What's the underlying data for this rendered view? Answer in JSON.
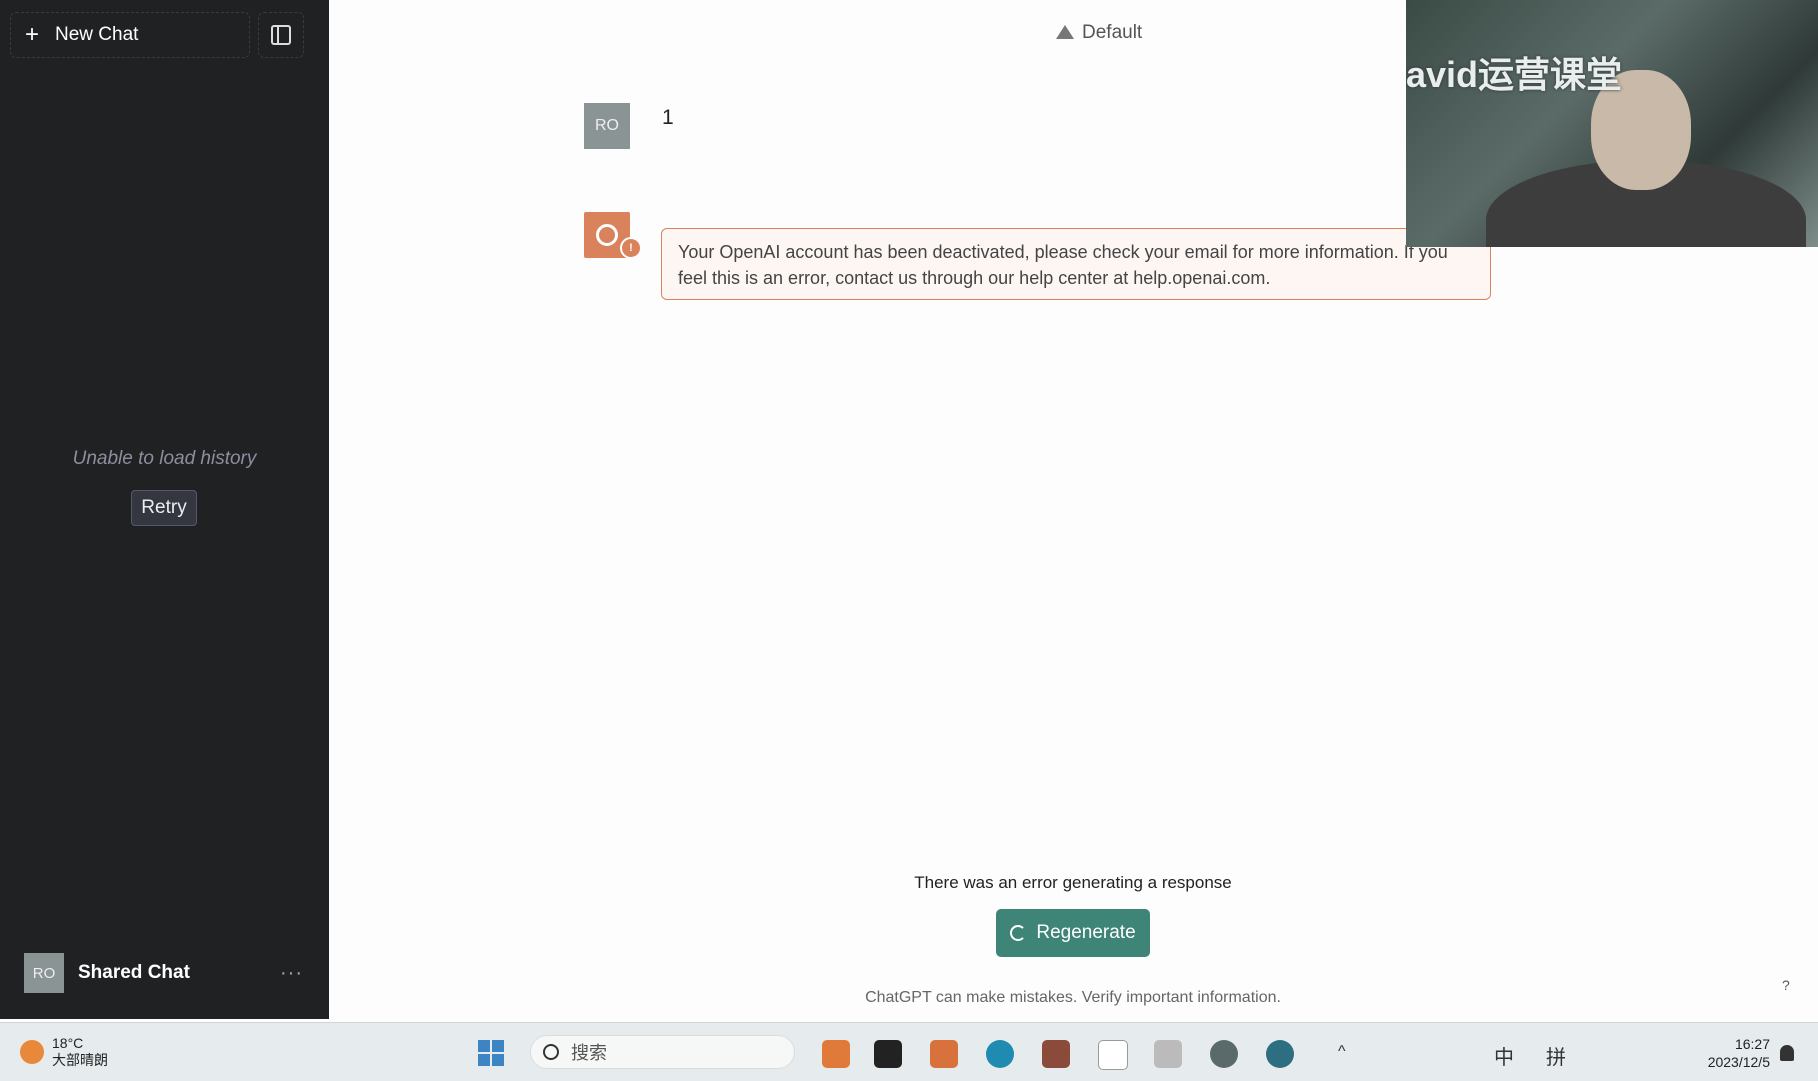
{
  "sidebar": {
    "new_chat_label": "New Chat",
    "history_error": "Unable to load history",
    "retry_label": "Retry",
    "user": {
      "initials": "RO",
      "name": "Shared Chat",
      "more": "···"
    }
  },
  "header": {
    "model": "Default"
  },
  "conversation": {
    "user_initials": "RO",
    "user_message": "1",
    "assistant_warning_mark": "!",
    "assistant_error": "Your OpenAI account has been deactivated, please check your email for more information. If you feel this is an error, contact us through our help center at help.openai.com."
  },
  "webcam": {
    "overlay_text": "avid运营课堂"
  },
  "footer": {
    "generation_error": "There was an error generating a response",
    "regenerate_label": "Regenerate",
    "disclaimer": "ChatGPT can make mistakes. Verify important information.",
    "help": "?"
  },
  "taskbar": {
    "weather_temp": "18°C",
    "weather_desc": "大部晴朗",
    "search_placeholder": "搜索",
    "tray_lang": "中",
    "tray_ime": "拼",
    "time": "16:27",
    "date": "2023/12/5"
  },
  "colors": {
    "sidebar_bg": "#202123",
    "accent": "#3e8477",
    "error": "#d9825c"
  }
}
